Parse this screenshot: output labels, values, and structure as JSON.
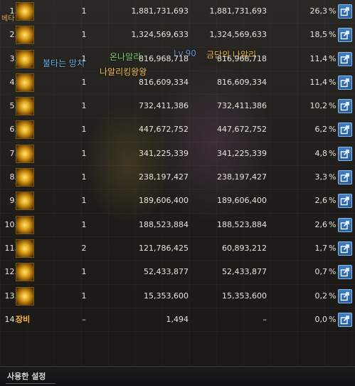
{
  "overlay": {
    "name1": "불타는 망치",
    "name2": "온나알리",
    "name3": "나알리킹왕왕",
    "level_text": "Lv.90",
    "name4": "금단의 나알리",
    "corner_text": "베타"
  },
  "rows": [
    {
      "rank": "1.",
      "hits": "1",
      "total": "1,881,731,693",
      "per_hit": "1,881,731,693",
      "percent": "26,3",
      "icon": "skill-icon"
    },
    {
      "rank": "2.",
      "hits": "1",
      "total": "1,324,569,633",
      "per_hit": "1,324,569,633",
      "percent": "18,5",
      "icon": "skill-icon"
    },
    {
      "rank": "3.",
      "hits": "1",
      "total": "816,968,718",
      "per_hit": "816,968,718",
      "percent": "11,4",
      "icon": "skill-icon"
    },
    {
      "rank": "4.",
      "hits": "1",
      "total": "816,609,334",
      "per_hit": "816,609,334",
      "percent": "11,4",
      "icon": "skill-icon"
    },
    {
      "rank": "5.",
      "hits": "1",
      "total": "732,411,386",
      "per_hit": "732,411,386",
      "percent": "10,2",
      "icon": "skill-icon"
    },
    {
      "rank": "6.",
      "hits": "1",
      "total": "447,672,752",
      "per_hit": "447,672,752",
      "percent": "6,2",
      "icon": "skill-icon"
    },
    {
      "rank": "7.",
      "hits": "1",
      "total": "341,225,339",
      "per_hit": "341,225,339",
      "percent": "4,8",
      "icon": "skill-icon"
    },
    {
      "rank": "8.",
      "hits": "1",
      "total": "238,197,427",
      "per_hit": "238,197,427",
      "percent": "3,3",
      "icon": "skill-icon"
    },
    {
      "rank": "9.",
      "hits": "1",
      "total": "189,606,400",
      "per_hit": "189,606,400",
      "percent": "2,6",
      "icon": "skill-icon"
    },
    {
      "rank": "10.",
      "hits": "1",
      "total": "188,523,884",
      "per_hit": "188,523,884",
      "percent": "2,6",
      "icon": "skill-icon"
    },
    {
      "rank": "11.",
      "hits": "2",
      "total": "121,786,425",
      "per_hit": "60,893,212",
      "percent": "1,7",
      "icon": "skill-icon"
    },
    {
      "rank": "12.",
      "hits": "1",
      "total": "52,433,877",
      "per_hit": "52,433,877",
      "percent": "0,7",
      "icon": "skill-icon"
    },
    {
      "rank": "13.",
      "hits": "1",
      "total": "15,353,600",
      "per_hit": "15,353,600",
      "percent": "0,2",
      "icon": "skill-icon"
    },
    {
      "rank": "14.",
      "hits": "–",
      "total": "1,494",
      "per_hit": "–",
      "percent": "0,0",
      "icon": "equip-label",
      "label": "장비"
    }
  ],
  "percent_sign": "%",
  "footer": {
    "label": "사용한 설정"
  },
  "colors": {
    "icon_gold": "#e0a51c",
    "share_button": "#2f6fb4",
    "equip_label": "#ffb73a"
  }
}
